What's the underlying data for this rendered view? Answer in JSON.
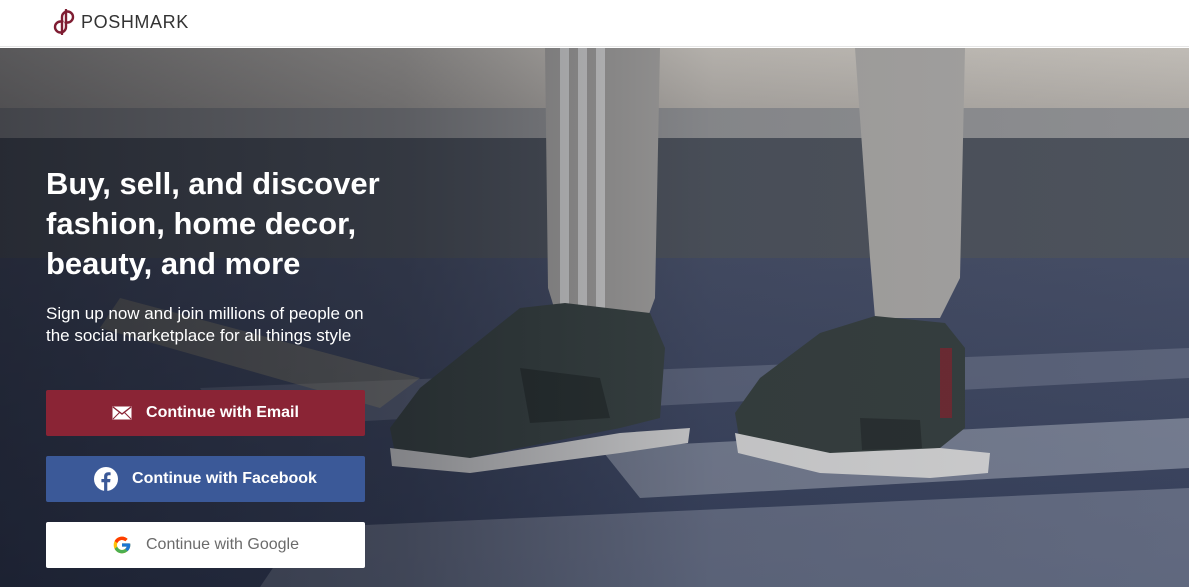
{
  "header": {
    "brand": "POSHMARK",
    "logo_icon": "poshmark-logo-icon"
  },
  "hero": {
    "headline": "Buy, sell, and discover fashion, home decor, beauty, and more",
    "subhead": "Sign up now and join millions of people on the social marketplace for all things style"
  },
  "buttons": {
    "email": {
      "label": "Continue with Email",
      "icon": "envelope-icon",
      "color": "#8a2435"
    },
    "facebook": {
      "label": "Continue with Facebook",
      "icon": "facebook-icon",
      "color": "#3b5998"
    },
    "google": {
      "label": "Continue with Google",
      "icon": "google-icon",
      "color": "#ffffff"
    }
  },
  "colors": {
    "brand": "#7f1d32",
    "email_button": "#8a2435",
    "facebook_button": "#3b5998"
  }
}
